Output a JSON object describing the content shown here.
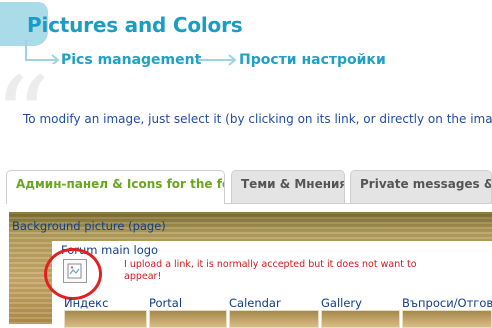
{
  "page": {
    "title": "Pictures and Colors"
  },
  "breadcrumb": {
    "items": [
      "Pics management",
      "Прости настройки"
    ]
  },
  "intro_text": "To modify an image, just select it (by clicking on its link, or directly on the image)",
  "tabs": [
    {
      "label": "Админ-панел & Icons for the forum",
      "active": true
    },
    {
      "label": "Теми & Мнения",
      "active": false
    },
    {
      "label": "Private messages & Calendar",
      "active": false
    }
  ],
  "panel": {
    "background_label": "Background picture (page)",
    "logo_label": "Forum main logo",
    "note": "I upload a link, it is normally accepted but it does not want to appear!",
    "nav_items": [
      "Индекс",
      "Portal",
      "Calendar",
      "Gallery",
      "Въпроси/Отговори"
    ]
  },
  "colors": {
    "title": "#1b9cc4",
    "breadcrumb": "#21a0c6",
    "active_tab": "#6aa624",
    "link": "#123e8a",
    "annotation": "#e32020"
  },
  "icons": {
    "breadcrumb_arrow": "arrow-right-icon",
    "logo_placeholder": "broken-image-icon",
    "decor_quote": "quote-icon"
  }
}
